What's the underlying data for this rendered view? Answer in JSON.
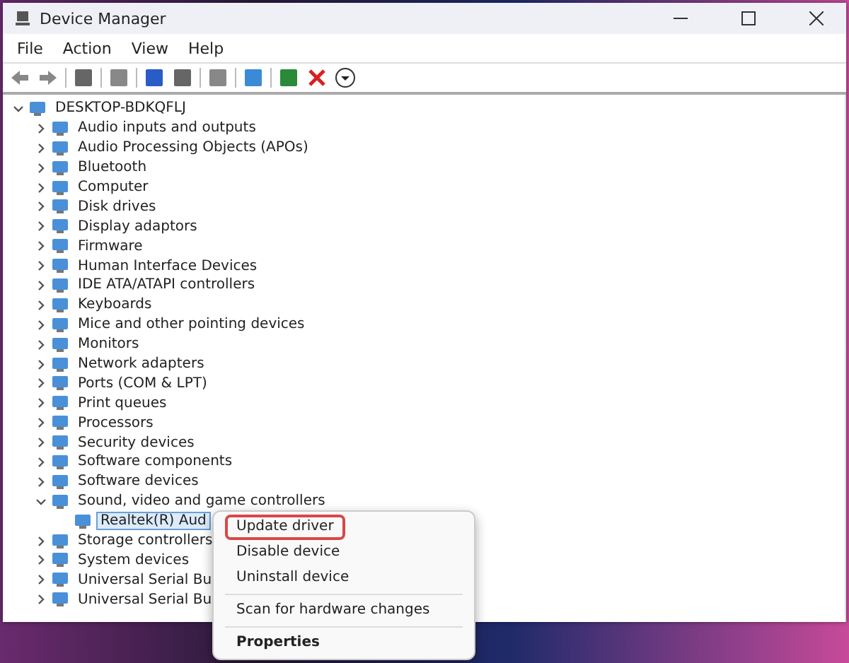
{
  "window": {
    "title": "Device Manager"
  },
  "menu_bar": [
    "File",
    "Action",
    "View",
    "Help"
  ],
  "tree": [
    {
      "label": "DESKTOP-BDKQFLJ",
      "expanded": true,
      "selected": false,
      "children": [
        {
          "label": "Audio inputs and outputs",
          "expanded": false,
          "selected": false
        },
        {
          "label": "Audio Processing Objects (APOs)",
          "expanded": false,
          "selected": false
        },
        {
          "label": "Bluetooth",
          "expanded": false,
          "selected": false
        },
        {
          "label": "Computer",
          "expanded": false,
          "selected": false
        },
        {
          "label": "Disk drives",
          "expanded": false,
          "selected": false
        },
        {
          "label": "Display adaptors",
          "expanded": false,
          "selected": false
        },
        {
          "label": "Firmware",
          "expanded": false,
          "selected": false
        },
        {
          "label": "Human Interface Devices",
          "expanded": false,
          "selected": false
        },
        {
          "label": "IDE ATA/ATAPI controllers",
          "expanded": false,
          "selected": false
        },
        {
          "label": "Keyboards",
          "expanded": false,
          "selected": false
        },
        {
          "label": "Mice and other pointing devices",
          "expanded": false,
          "selected": false
        },
        {
          "label": "Monitors",
          "expanded": false,
          "selected": false
        },
        {
          "label": "Network adapters",
          "expanded": false,
          "selected": false
        },
        {
          "label": "Ports (COM & LPT)",
          "expanded": false,
          "selected": false
        },
        {
          "label": "Print queues",
          "expanded": false,
          "selected": false
        },
        {
          "label": "Processors",
          "expanded": false,
          "selected": false
        },
        {
          "label": "Security devices",
          "expanded": false,
          "selected": false
        },
        {
          "label": "Software components",
          "expanded": false,
          "selected": false
        },
        {
          "label": "Software devices",
          "expanded": false,
          "selected": false
        },
        {
          "label": "Sound, video and game controllers",
          "expanded": true,
          "selected": false,
          "children": [
            {
              "label": "Realtek(R) Aud",
              "selected": true
            }
          ]
        },
        {
          "label": "Storage controllers",
          "expanded": false,
          "selected": false
        },
        {
          "label": "System devices",
          "expanded": false,
          "selected": false
        },
        {
          "label": "Universal Serial Bu",
          "expanded": false,
          "selected": false
        },
        {
          "label": "Universal Serial Bu",
          "expanded": false,
          "selected": false
        }
      ]
    }
  ],
  "context_menu": [
    {
      "kind": "item",
      "label": "Update driver",
      "highlighted": true,
      "default": false
    },
    {
      "kind": "item",
      "label": "Disable device",
      "highlighted": false,
      "default": false
    },
    {
      "kind": "item",
      "label": "Uninstall device",
      "highlighted": false,
      "default": false
    },
    {
      "kind": "separator"
    },
    {
      "kind": "item",
      "label": "Scan for hardware changes",
      "highlighted": false,
      "default": false
    },
    {
      "kind": "separator"
    },
    {
      "kind": "item",
      "label": "Properties",
      "highlighted": false,
      "default": true
    }
  ]
}
